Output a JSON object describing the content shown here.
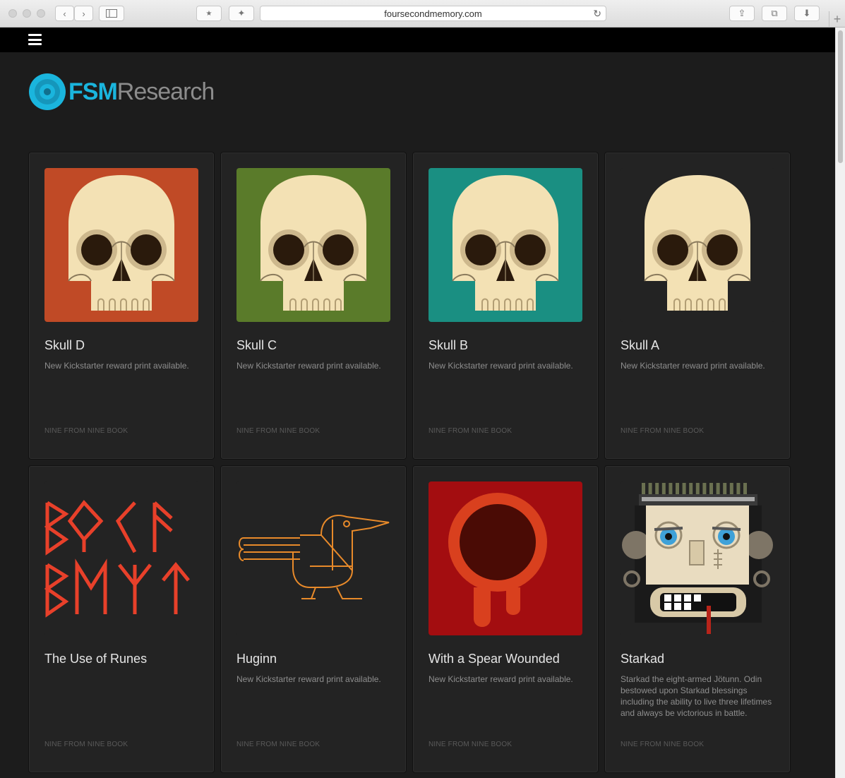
{
  "browser": {
    "url": "foursecondmemory.com"
  },
  "logo": {
    "brand": "FSM",
    "suffix": "Research"
  },
  "cards": [
    {
      "title": "Skull D",
      "description": "New Kickstarter reward print available.",
      "category": "NINE FROM NINE BOOK",
      "art": "skull",
      "bg": "#c04a26"
    },
    {
      "title": "Skull C",
      "description": "New Kickstarter reward print available.",
      "category": "NINE FROM NINE BOOK",
      "art": "skull",
      "bg": "#5a7b2a"
    },
    {
      "title": "Skull B",
      "description": "New Kickstarter reward print available.",
      "category": "NINE FROM NINE BOOK",
      "art": "skull",
      "bg": "#1a8f82"
    },
    {
      "title": "Skull A",
      "description": "New Kickstarter reward print available.",
      "category": "NINE FROM NINE BOOK",
      "art": "skull",
      "bg": "#232323"
    },
    {
      "title": "The Use of Runes",
      "description": "",
      "category": "NINE FROM NINE BOOK",
      "art": "runes",
      "bg": "#232323"
    },
    {
      "title": "Huginn",
      "description": "New Kickstarter reward print available.",
      "category": "NINE FROM NINE BOOK",
      "art": "raven",
      "bg": "#232323"
    },
    {
      "title": "With a Spear Wounded",
      "description": "New Kickstarter reward print available.",
      "category": "NINE FROM NINE BOOK",
      "art": "spear",
      "bg": "#a30d10"
    },
    {
      "title": "Starkad",
      "description": "Starkad the eight-armed Jötunn. Odin bestowed upon Starkad blessings including the ability to live three lifetimes and always be victorious in battle.",
      "category": "NINE FROM NINE BOOK",
      "art": "starkad",
      "bg": "#232323"
    }
  ]
}
